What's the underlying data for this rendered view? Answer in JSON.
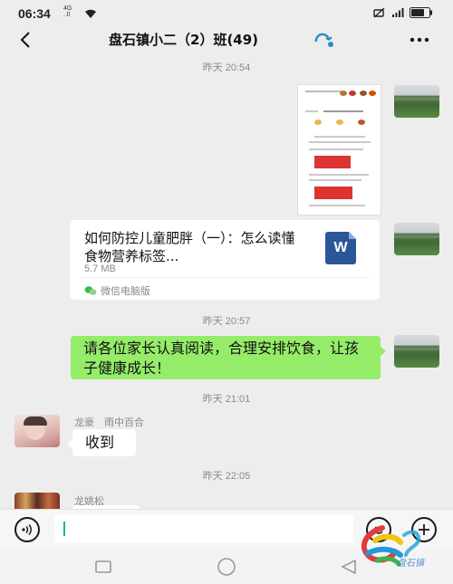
{
  "status": {
    "time": "06:34",
    "network_top": "4G",
    "network_bottom": "..ll"
  },
  "header": {
    "back_icon": "chevron-left-icon",
    "title": "盘石镇小二（2）班(49)",
    "more_label": "···"
  },
  "messages": {
    "time1": "昨天 20:54",
    "file": {
      "title": "如何防控儿童肥胖（一）：怎么读懂食物营养标签...",
      "size": "5.7 MB",
      "icon_letter": "W",
      "source": "微信电脑版"
    },
    "time2": "昨天 20:57",
    "notice": "请各位家长认真阅读，合理安排饮食，让孩子健康成长！",
    "time3": "昨天 21:01",
    "reply_sender": "龙豪　雨中百合",
    "reply_text": "收到",
    "time4": "昨天 22:05",
    "last_sender": "龙姚松"
  },
  "input": {
    "placeholder": ""
  },
  "colors": {
    "background": "#ededed",
    "bubble_self": "#95ec69",
    "bubble_other": "#ffffff",
    "accent_green": "#07c160",
    "word_blue": "#2b5797"
  }
}
